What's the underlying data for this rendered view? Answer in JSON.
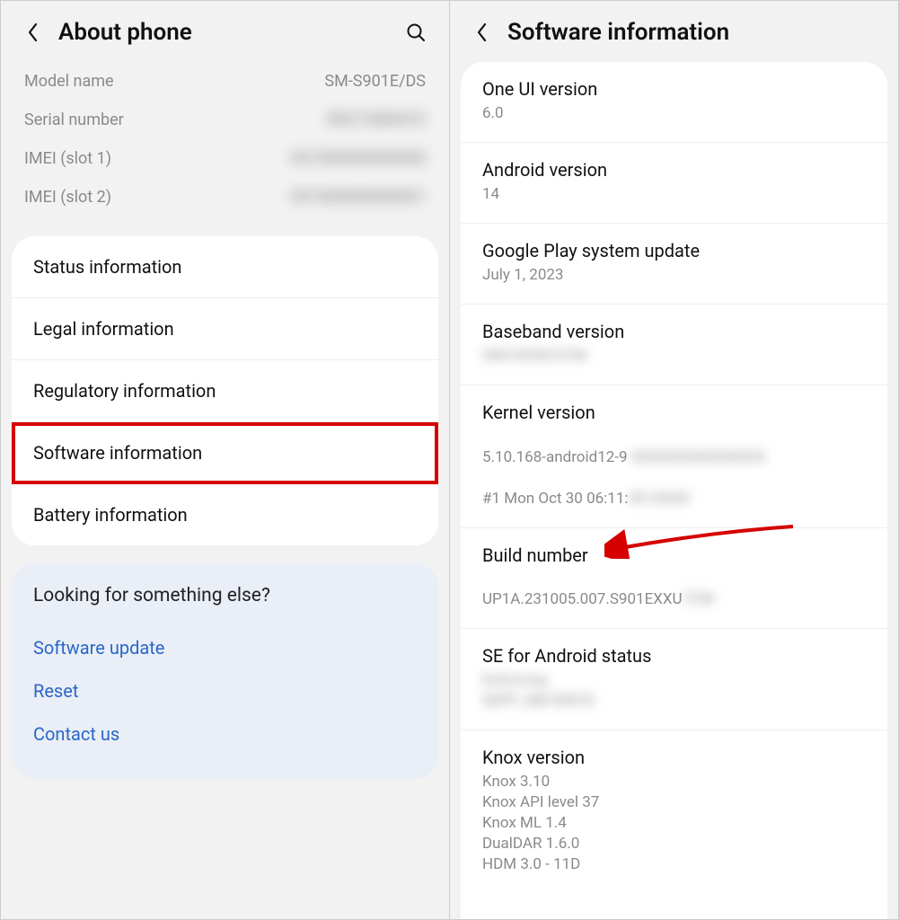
{
  "left": {
    "title": "About phone",
    "ident": {
      "model_label": "Model name",
      "model_value": "SM-S901E/DS",
      "serial_label": "Serial number",
      "serial_value": "R5CT30NXYZ",
      "imei1_label": "IMEI (slot 1)",
      "imei1_value": "357300000000000",
      "imei2_label": "IMEI (slot 2)",
      "imei2_value": "357300000000001"
    },
    "rows": {
      "status": "Status information",
      "legal": "Legal information",
      "regulatory": "Regulatory information",
      "software": "Software information",
      "battery": "Battery information"
    },
    "info": {
      "heading": "Looking for something else?",
      "software_update": "Software update",
      "reset": "Reset",
      "contact": "Contact us"
    }
  },
  "right": {
    "title": "Software information",
    "rows": {
      "oneui_label": "One UI version",
      "oneui_value": "6.0",
      "android_label": "Android version",
      "android_value": "14",
      "gplay_label": "Google Play system update",
      "gplay_value": "July 1, 2023",
      "baseband_label": "Baseband version",
      "baseband_value": "S901EXXU7CW",
      "kernel_label": "Kernel version",
      "kernel_line1_a": "5.10.168-android12-9",
      "kernel_line1_b": "-XXXXXXXXXXXXXX",
      "kernel_line2_a": "#1 Mon Oct 30 06:11:",
      "kernel_line2_b": "XX XXXX",
      "build_label": "Build number",
      "build_value_a": "UP1A.231005.007.S901EXXU",
      "build_value_b": "7CW",
      "se_label": "SE for Android status",
      "se_value": "Enforcing\nSEPF_SM-S901E",
      "knox_label": "Knox version",
      "knox_value": "Knox 3.10\nKnox API level 37\nKnox ML 1.4\nDualDAR 1.6.0\nHDM 3.0 - 11D"
    }
  }
}
